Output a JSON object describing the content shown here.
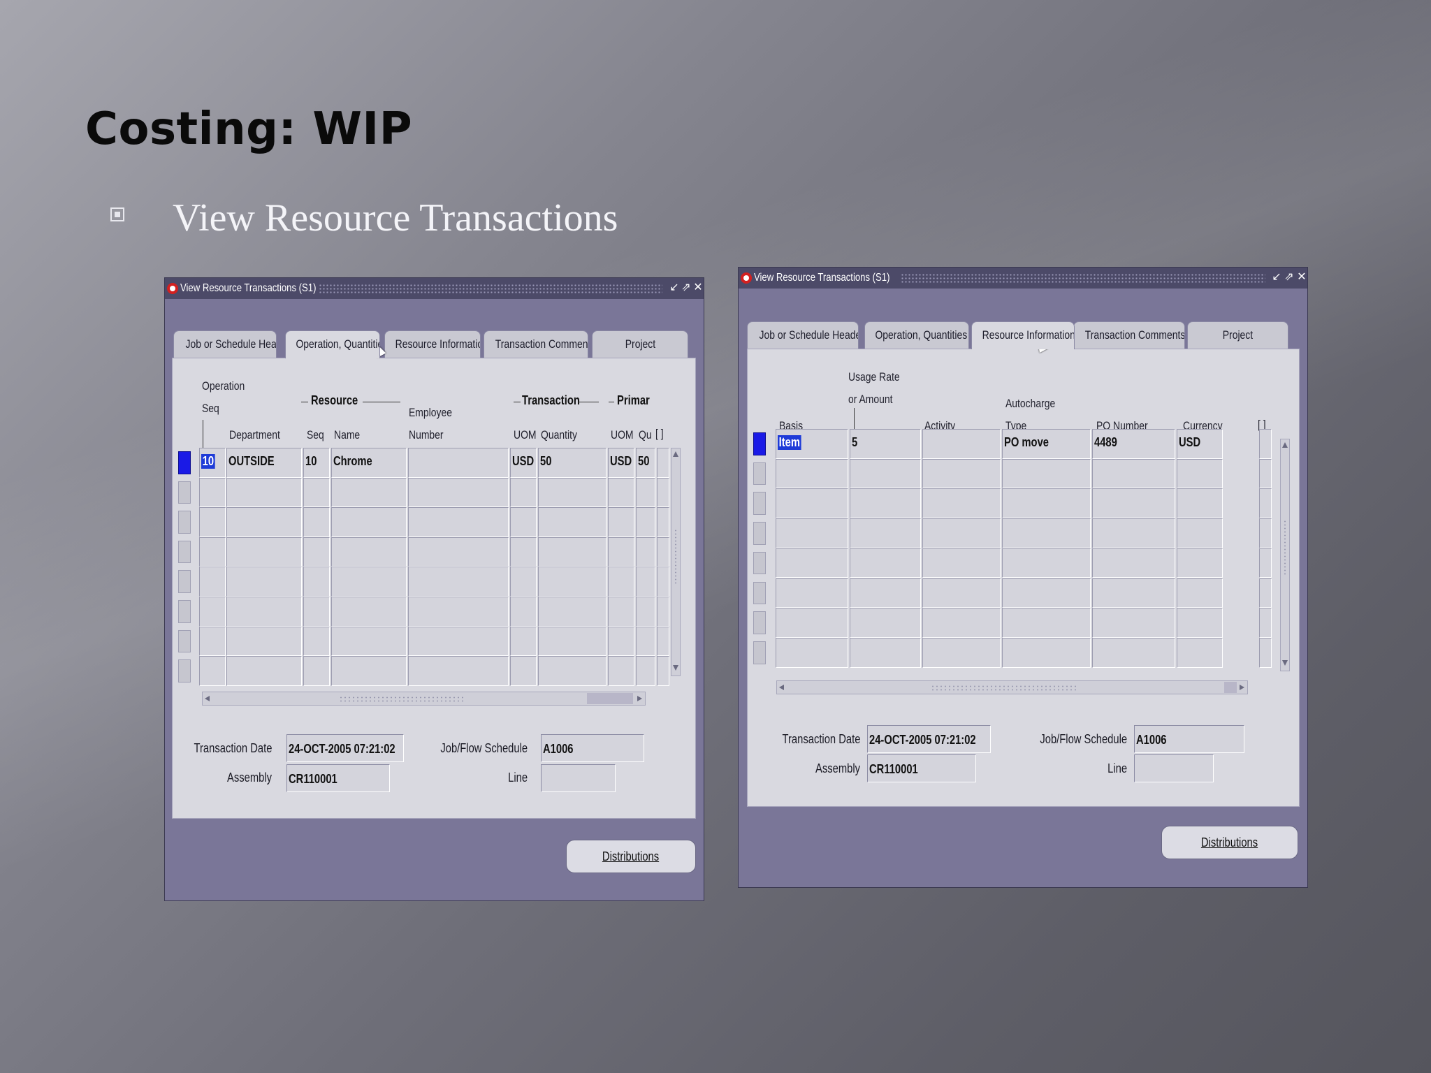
{
  "slide": {
    "title": "Costing: WIP",
    "bullet": "View Resource Transactions"
  },
  "colors": {
    "window_bg": "#7a7698",
    "titlebar_bg": "#4c4a68",
    "panel_bg": "#d9d9e0",
    "selected_row_indicator": "#1a1ae6",
    "selected_cell": "#1e3bd8"
  },
  "window_left": {
    "title": "View Resource Transactions (S1)",
    "controls": [
      "minimize-icon",
      "maximize-icon",
      "close-icon"
    ],
    "tabs": [
      "Job or Schedule Header",
      "Operation, Quantities",
      "Resource Information",
      "Transaction Comments",
      "Project"
    ],
    "active_tab": "Operation, Quantities",
    "group_labels": {
      "resource": "Resource",
      "transaction": "Transaction",
      "primary": "Primar"
    },
    "headers": {
      "operation_seq_1": "Operation",
      "operation_seq_2": "Seq",
      "department": "Department",
      "seq": "Seq",
      "name": "Name",
      "employee_number_1": "Employee",
      "employee_number_2": "Number",
      "trx_uom": "UOM",
      "trx_quantity": "Quantity",
      "pri_uom": "UOM",
      "pri_qty": "Qu",
      "bracket": "[ ]"
    },
    "row1": {
      "op_seq": "10",
      "department": "OUTSIDE",
      "seq": "10",
      "name": "Chrome",
      "employee": "",
      "trx_uom": "USD",
      "trx_qty": "50",
      "pri_uom": "USD",
      "pri_qty": "50"
    },
    "footer": {
      "transaction_date_label": "Transaction Date",
      "transaction_date": "24-OCT-2005 07:21:02",
      "assembly_label": "Assembly",
      "assembly": "CR110001",
      "job_label": "Job/Flow Schedule",
      "job": "A1006",
      "line_label": "Line",
      "line": ""
    },
    "button": "Distributions"
  },
  "window_right": {
    "title": "View Resource Transactions (S1)",
    "controls": [
      "minimize-icon",
      "maximize-icon",
      "close-icon"
    ],
    "tabs": [
      "Job or Schedule Header",
      "Operation, Quantities",
      "Resource Information",
      "Transaction Comments",
      "Project"
    ],
    "active_tab": "Resource Information",
    "headers": {
      "basis": "Basis",
      "usage_1": "Usage Rate",
      "usage_2": "or Amount",
      "activity": "Activity",
      "autocharge_1": "Autocharge",
      "autocharge_2": "Type",
      "po_number": "PO Number",
      "currency": "Currency",
      "bracket": "[ ]"
    },
    "row1": {
      "basis": "Item",
      "usage": "5",
      "activity": "",
      "autocharge": "PO move",
      "po_number": "4489",
      "currency": "USD"
    },
    "footer": {
      "transaction_date_label": "Transaction Date",
      "transaction_date": "24-OCT-2005 07:21:02",
      "assembly_label": "Assembly",
      "assembly": "CR110001",
      "job_label": "Job/Flow Schedule",
      "job": "A1006",
      "line_label": "Line",
      "line": ""
    },
    "button": "Distributions"
  }
}
